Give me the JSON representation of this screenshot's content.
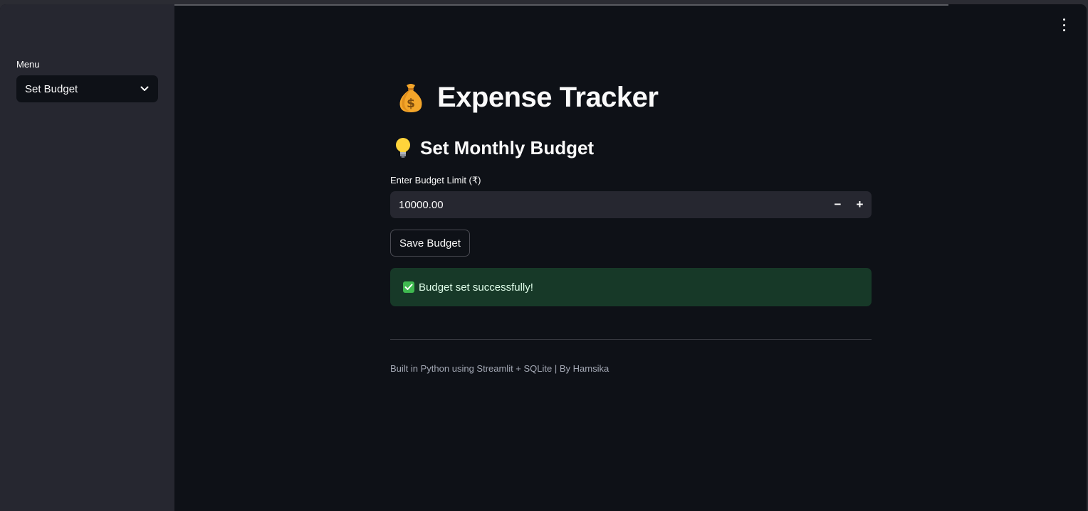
{
  "sidebar": {
    "menu_label": "Menu",
    "selected_option": "Set Budget"
  },
  "header": {
    "title_emoji": "money-bag",
    "title": "Expense Tracker"
  },
  "section": {
    "emoji": "light-bulb",
    "title": "Set Monthly Budget"
  },
  "budget_form": {
    "label": "Enter Budget Limit (₹)",
    "value": "10000.00",
    "decrement_label": "−",
    "increment_label": "+",
    "save_label": "Save Budget"
  },
  "alert": {
    "icon": "check-mark-button",
    "message": "Budget set successfully!",
    "color": "#173928"
  },
  "footer": {
    "text": "Built in Python using Streamlit + SQLite | By Hamsika"
  },
  "colors": {
    "background": "#0e1117",
    "sidebar": "#262730",
    "text": "#fafafa",
    "success": "#3fb950"
  }
}
